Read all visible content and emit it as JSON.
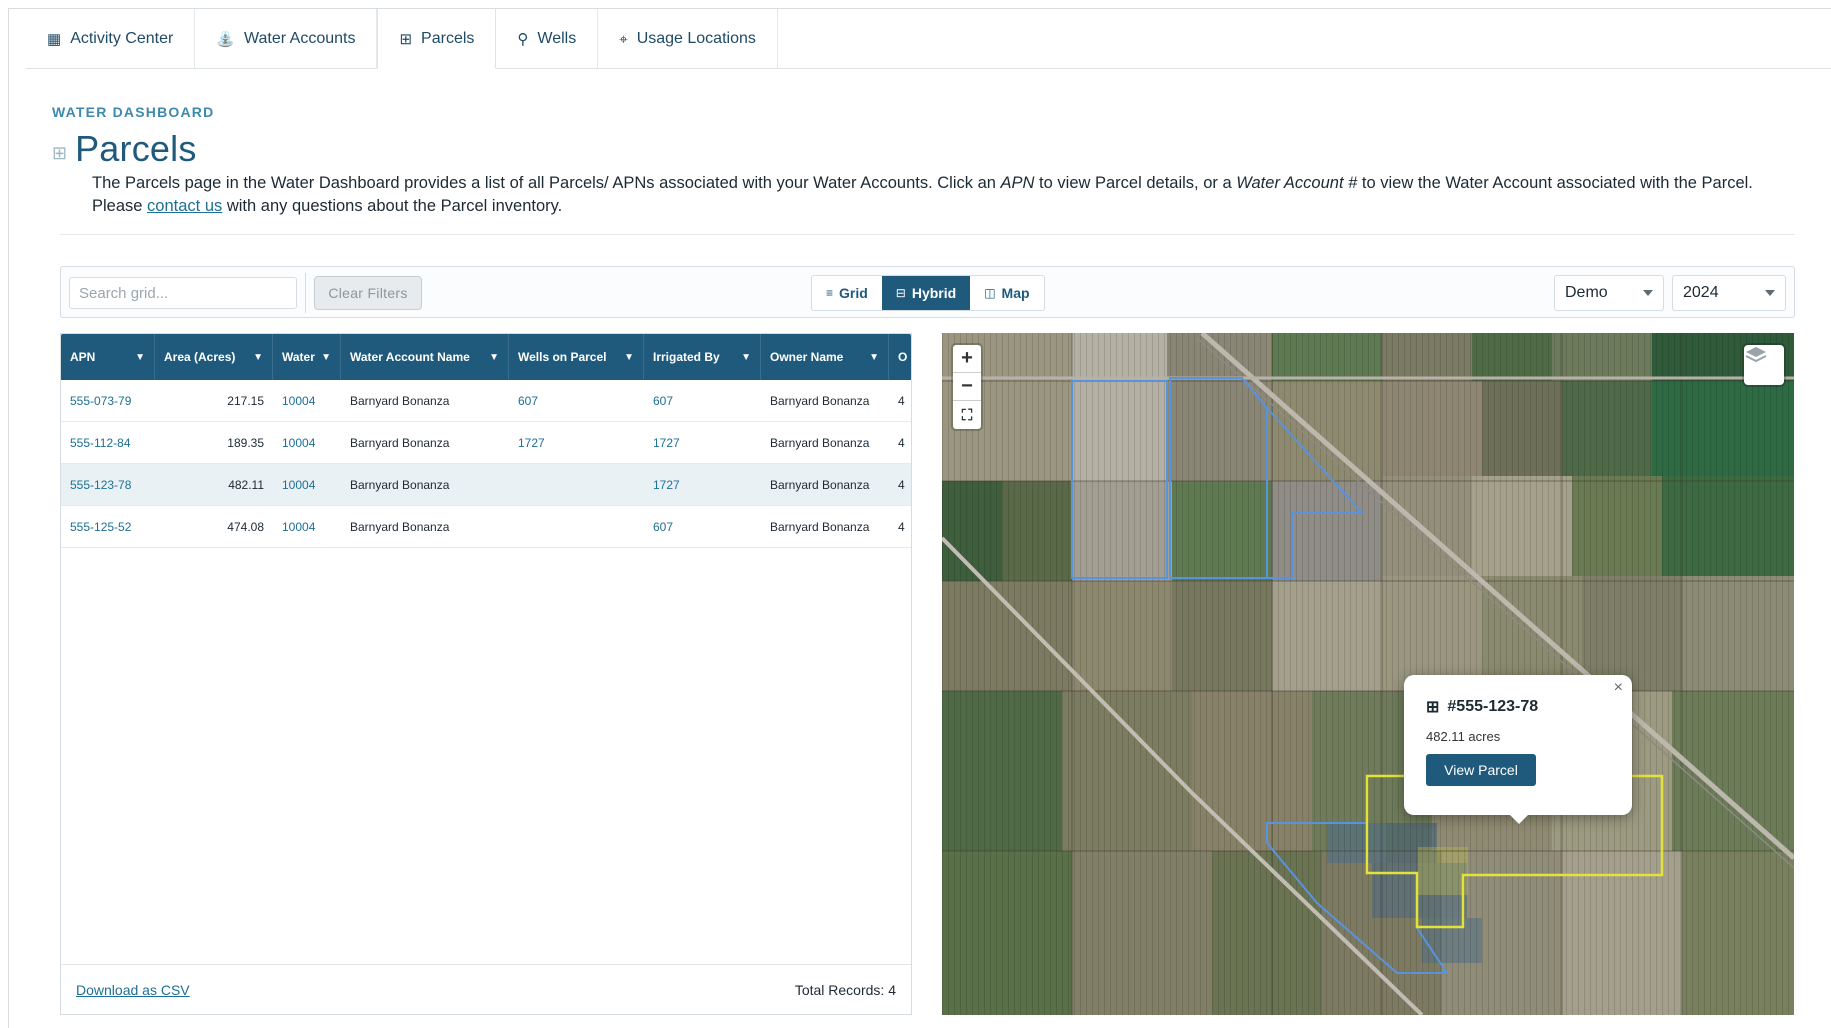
{
  "nav": {
    "tabs": [
      {
        "label": "Activity Center",
        "icon": "dashboard-icon"
      },
      {
        "label": "Water Accounts",
        "icon": "water-account-icon"
      },
      {
        "label": "Parcels",
        "icon": "parcel-grid-icon",
        "active": true
      },
      {
        "label": "Wells",
        "icon": "well-icon"
      },
      {
        "label": "Usage Locations",
        "icon": "map-marker-icon"
      }
    ]
  },
  "header": {
    "eyebrow": "WATER DASHBOARD",
    "title": "Parcels",
    "desc_1": "The Parcels page in the Water Dashboard provides a list of all Parcels/ APNs associated with your Water Accounts. Click an ",
    "desc_apn": "APN",
    "desc_2": " to view Parcel details, or a ",
    "desc_wa": "Water Account #",
    "desc_3": " to view the Water Account associated with the Parcel. Please ",
    "desc_link": "contact us",
    "desc_4": " with any questions about the Parcel inventory."
  },
  "toolbar": {
    "search_placeholder": "Search grid...",
    "clear_filters": "Clear Filters",
    "views": [
      {
        "label": "Grid",
        "glyph": "≡"
      },
      {
        "label": "Hybrid",
        "glyph": "⊟",
        "active": true
      },
      {
        "label": "Map",
        "glyph": "◫"
      }
    ],
    "geography": "Demo",
    "year": "2024"
  },
  "grid": {
    "columns": [
      "APN",
      "Area (Acres)",
      "Water",
      "Water Account Name",
      "Wells on Parcel",
      "Irrigated By",
      "Owner Name",
      "O"
    ],
    "rows": [
      {
        "apn": "555-073-79",
        "area": "217.15",
        "water": "10004",
        "name": "Barnyard Bonanza",
        "wells": "607",
        "irrigated": "607",
        "owner": "Barnyard Bonanza",
        "extra": "4"
      },
      {
        "apn": "555-112-84",
        "area": "189.35",
        "water": "10004",
        "name": "Barnyard Bonanza",
        "wells": "1727",
        "irrigated": "1727",
        "owner": "Barnyard Bonanza",
        "extra": "4"
      },
      {
        "apn": "555-123-78",
        "area": "482.11",
        "water": "10004",
        "name": "Barnyard Bonanza",
        "wells": "",
        "irrigated": "1727",
        "owner": "Barnyard Bonanza",
        "extra": "4",
        "selected": true
      },
      {
        "apn": "555-125-52",
        "area": "474.08",
        "water": "10004",
        "name": "Barnyard Bonanza",
        "wells": "",
        "irrigated": "607",
        "owner": "Barnyard Bonanza",
        "extra": "4"
      }
    ],
    "download": "Download as CSV",
    "total": "Total Records: 4"
  },
  "map": {
    "zoom_in": "+",
    "zoom_out": "−",
    "fullscreen": "⛶",
    "popup": {
      "title": "#555-123-78",
      "acres": "482.11 acres",
      "button": "View Parcel",
      "close": "×"
    },
    "colors": {
      "parcel_blue": "#4f8fd6",
      "parcel_yellow": "#e3e23a"
    }
  },
  "colors": {
    "primary": "#1f5a7d",
    "link": "#1c6f95",
    "eyebrow": "#3d8aae"
  }
}
